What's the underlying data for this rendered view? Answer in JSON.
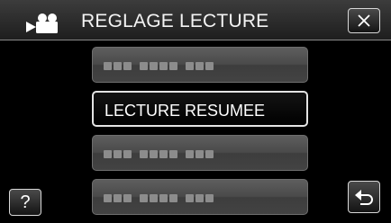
{
  "header": {
    "title": "REGLAGE LECTURE",
    "mode_icon": "video-camera-icon",
    "close_icon": "close-icon"
  },
  "menu": {
    "items": [
      {
        "label": "",
        "state": "placeholder"
      },
      {
        "label": "LECTURE RESUMEE",
        "state": "selected"
      },
      {
        "label": "",
        "state": "placeholder"
      },
      {
        "label": "",
        "state": "placeholder"
      }
    ]
  },
  "footer": {
    "help_label": "?",
    "help_icon": "help-icon",
    "back_icon": "return-arrow-icon"
  },
  "colors": {
    "background": "#000000",
    "header": "#2a2a2a",
    "button": "#4a4a4a",
    "border": "#d8d8d8",
    "text": "#ffffff"
  }
}
